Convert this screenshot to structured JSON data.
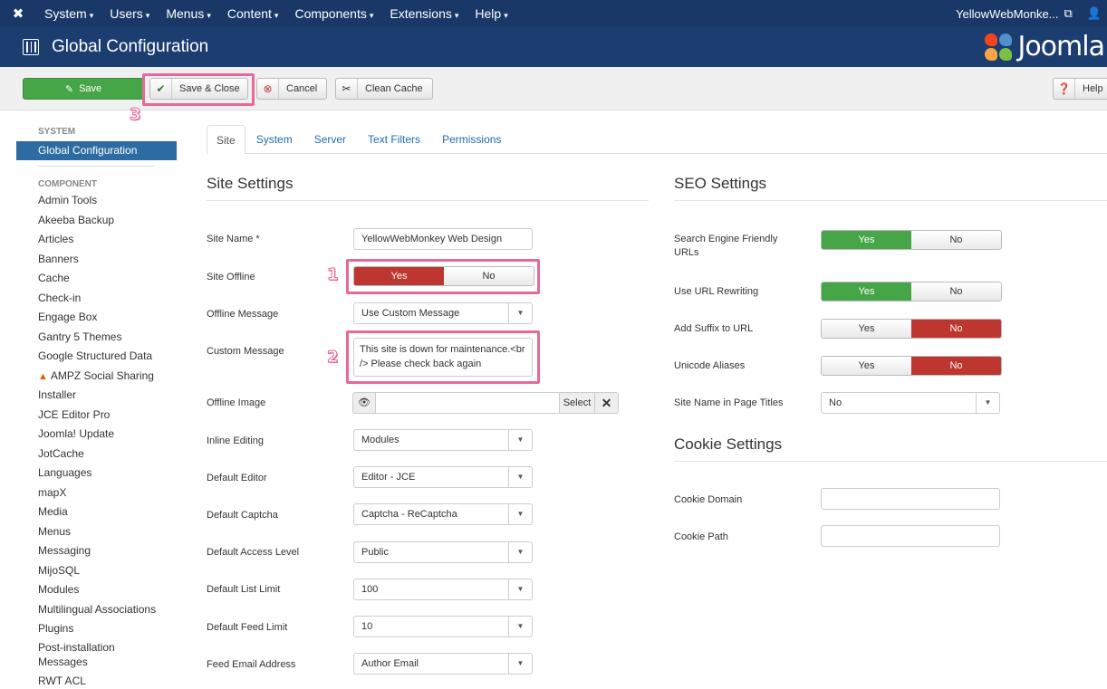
{
  "topnav": {
    "menus": [
      "System",
      "Users",
      "Menus",
      "Content",
      "Components",
      "Extensions",
      "Help"
    ],
    "user": "YellowWebMonke..."
  },
  "titlebar": {
    "title": "Global Configuration",
    "brand": "Joomla!"
  },
  "toolbar": {
    "save": "Save",
    "save_close": "Save & Close",
    "cancel": "Cancel",
    "clean_cache": "Clean Cache",
    "help": "Help"
  },
  "annotations": {
    "one": "1",
    "two": "2",
    "three": "3"
  },
  "sidebar": {
    "system_heading": "SYSTEM",
    "active": "Global Configuration",
    "component_heading": "COMPONENT",
    "items": [
      "Admin Tools",
      "Akeeba Backup",
      "Articles",
      "Banners",
      "Cache",
      "Check-in",
      "Engage Box",
      "Gantry 5 Themes",
      "Google Structured Data",
      "AMPZ Social Sharing",
      "Installer",
      "JCE Editor Pro",
      "Joomla! Update",
      "JotCache",
      "Languages",
      "mapX",
      "Media",
      "Menus",
      "Messaging",
      "MijoSQL",
      "Modules",
      "Multilingual Associations",
      "Plugins",
      "Post-installation Messages",
      "RWT ACL"
    ]
  },
  "tabs": [
    "Site",
    "System",
    "Server",
    "Text Filters",
    "Permissions"
  ],
  "site": {
    "title": "Site Settings",
    "site_name_label": "Site Name *",
    "site_name_value": "YellowWebMonkey Web Design",
    "site_offline_label": "Site Offline",
    "yes": "Yes",
    "no": "No",
    "offline_message_label": "Offline Message",
    "offline_message_value": "Use Custom Message",
    "custom_message_label": "Custom Message",
    "custom_message_value": "This site is down for maintenance.<br /> Please check back again",
    "offline_image_label": "Offline Image",
    "select": "Select",
    "inline_editing_label": "Inline Editing",
    "inline_editing_value": "Modules",
    "default_editor_label": "Default Editor",
    "default_editor_value": "Editor - JCE",
    "default_captcha_label": "Default Captcha",
    "default_captcha_value": "Captcha - ReCaptcha",
    "access_level_label": "Default Access Level",
    "access_level_value": "Public",
    "list_limit_label": "Default List Limit",
    "list_limit_value": "100",
    "feed_limit_label": "Default Feed Limit",
    "feed_limit_value": "10",
    "feed_email_label": "Feed Email Address",
    "feed_email_value": "Author Email"
  },
  "seo": {
    "title": "SEO Settings",
    "sef_label": "Search Engine Friendly URLs",
    "rewrite_label": "Use URL Rewriting",
    "suffix_label": "Add Suffix to URL",
    "unicode_label": "Unicode Aliases",
    "sitename_titles_label": "Site Name in Page Titles",
    "sitename_titles_value": "No"
  },
  "cookie": {
    "title": "Cookie Settings",
    "domain_label": "Cookie Domain",
    "path_label": "Cookie Path"
  },
  "colors": {
    "nav": "#1a3867",
    "green": "#46a546",
    "red": "#bd362f",
    "highlight": "#e8689a",
    "link": "#1f6bb0"
  }
}
